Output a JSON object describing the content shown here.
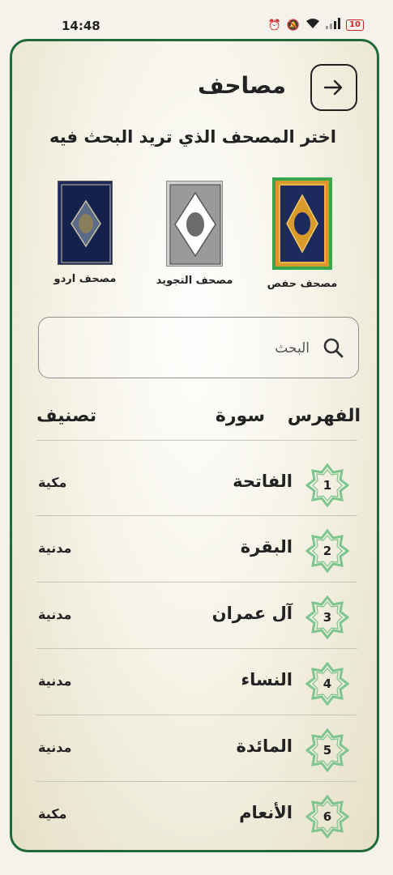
{
  "status_bar": {
    "time": "14:48",
    "battery": "10"
  },
  "header": {
    "title": "مصاحف",
    "back_icon": "arrow-right-icon"
  },
  "subtitle": "اختر المصحف الذي تريد البحث فيه",
  "books": [
    {
      "label": "مصحف حفص",
      "selected": true,
      "cover_color": "#d89a2a",
      "center_color": "#1c2a5e"
    },
    {
      "label": "مصحف التجويد",
      "selected": false,
      "cover_color": "#d0d0d0",
      "center_color": "#ffffff"
    },
    {
      "label": "مصحف اردو",
      "selected": false,
      "cover_color": "#1c2a5e",
      "center_color": "#8a7f5c"
    }
  ],
  "search": {
    "placeholder": "البحث",
    "value": ""
  },
  "columns": {
    "index": "الفهرس",
    "surah": "سورة",
    "type": "تصنيف"
  },
  "surahs": [
    {
      "number": "1",
      "name": "الفاتحة",
      "type": "مكية"
    },
    {
      "number": "2",
      "name": "البقرة",
      "type": "مدنية"
    },
    {
      "number": "3",
      "name": "آل عمران",
      "type": "مدنية"
    },
    {
      "number": "4",
      "name": "النساء",
      "type": "مدنية"
    },
    {
      "number": "5",
      "name": "المائدة",
      "type": "مدنية"
    },
    {
      "number": "6",
      "name": "الأنعام",
      "type": "مكية"
    }
  ],
  "colors": {
    "accent": "#1f6a3b",
    "star": "#7fc58f",
    "selected_border": "#3aa54a"
  }
}
